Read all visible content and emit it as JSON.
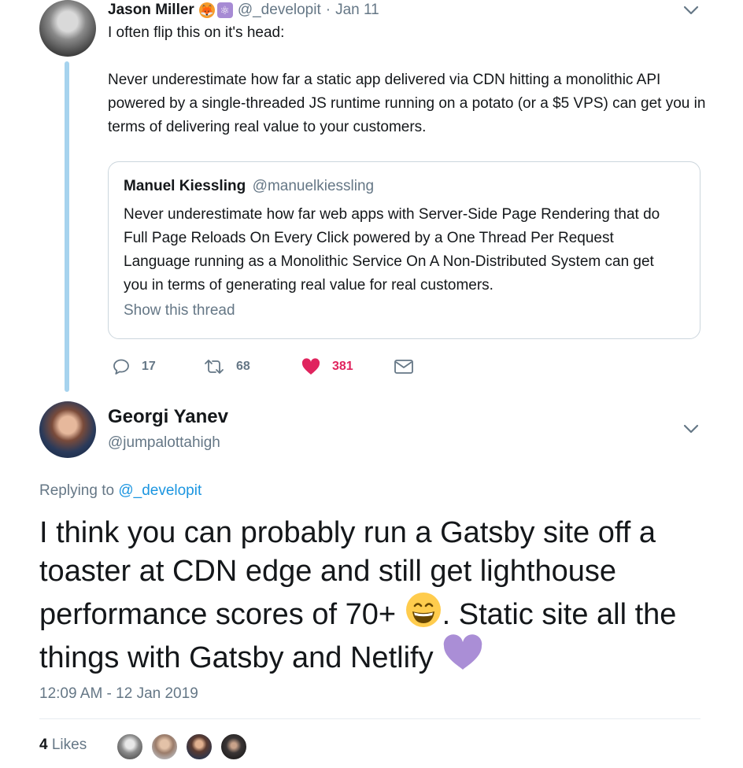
{
  "parent_tweet": {
    "author_name": "Jason Miller",
    "author_emoji_1": "🦊",
    "author_emoji_2": "⚛",
    "handle": "@_developit",
    "separator": "·",
    "date": "Jan 11",
    "line1": "I often flip this on it's head:",
    "paragraph": "Never underestimate how far a static app delivered via CDN hitting a monolithic API powered by a single-threaded JS runtime running on a potato (or a $5 VPS) can get you in terms of delivering real value to your customers.",
    "quoted_tweet": {
      "author_name": "Manuel Kiessling",
      "handle": "@manuelkiessling",
      "text": "Never underestimate how far web apps with Server-Side Page Rendering that do Full Page Reloads On Every Click powered by a One Thread Per Request Language running as a Monolithic Service On A Non-Distributed System can get you in terms of generating real value for real customers.",
      "show_thread": "Show this thread"
    },
    "actions": {
      "reply_count": "17",
      "retweet_count": "68",
      "like_count": "381"
    },
    "icons": [
      "chevron-down-icon",
      "reply-icon",
      "retweet-icon",
      "heart-icon",
      "mail-icon"
    ]
  },
  "main_tweet": {
    "author_name": "Georgi Yanev",
    "handle": "@jumpalottahigh",
    "replying_prefix": "Replying to",
    "replying_handle": "@_developit",
    "text_part1": "I think you can probably run a Gatsby site off a toaster at CDN edge and still get lighthouse performance scores of 70+",
    "text_part2": ". Static site all the things with Gatsby and Netlify",
    "timestamp": "12:09 AM - 12 Jan 2019",
    "likes_count": "4",
    "likes_label": "Likes",
    "emoji_grin": "grinning-face-emoji",
    "emoji_heart": "purple-heart-emoji"
  },
  "colors": {
    "text": "#14171a",
    "secondary": "#657786",
    "link": "#1b95e0",
    "like": "#e0245e",
    "thread_line": "#a6d3ee",
    "border": "#ccd6dd"
  }
}
